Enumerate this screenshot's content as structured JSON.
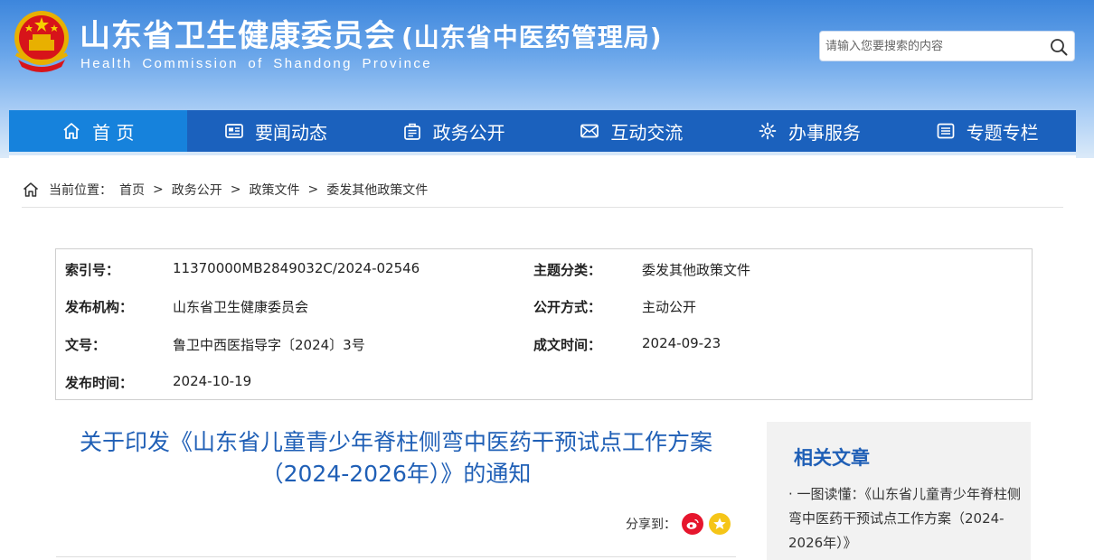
{
  "header": {
    "title": "山东省卫生健康委员会",
    "subtitle": "(山东省中医药管理局)",
    "english_name": "Health Commission of Shandong Province",
    "emblem_icon": "national-emblem-icon",
    "search": {
      "placeholder": "请输入您要搜索的内容",
      "icon": "search-icon"
    }
  },
  "nav": {
    "items": [
      {
        "label": "首 页",
        "icon": "home-icon",
        "active": true
      },
      {
        "label": "要闻动态",
        "icon": "news-icon"
      },
      {
        "label": "政务公开",
        "icon": "government-affairs-icon"
      },
      {
        "label": "互动交流",
        "icon": "envelope-icon"
      },
      {
        "label": "办事服务",
        "icon": "service-icon"
      },
      {
        "label": "专题专栏",
        "icon": "list-icon"
      }
    ]
  },
  "breadcrumb": {
    "prefix": "当前位置：",
    "items": [
      "首页",
      "政务公开",
      "政策文件",
      "委发其他政策文件"
    ],
    "separator": ">"
  },
  "metadata": {
    "index_no": {
      "label": "索引号：",
      "value": "11370000MB2849032C/2024-02546"
    },
    "topic": {
      "label": "主题分类：",
      "value": "委发其他政策文件"
    },
    "issuer": {
      "label": "发布机构：",
      "value": "山东省卫生健康委员会"
    },
    "disclosure": {
      "label": "公开方式：",
      "value": "主动公开"
    },
    "doc_no": {
      "label": "文号：",
      "value": "鲁卫中西医指导字〔2024〕3号"
    },
    "created": {
      "label": "成文时间：",
      "value": "2024-09-23"
    },
    "published": {
      "label": "发布时间：",
      "value": "2024-10-19"
    }
  },
  "article": {
    "title_line1": "关于印发《山东省儿童青少年脊柱侧弯中医药干预试点工作方案",
    "title_line2": "（2024-2026年）》的通知",
    "share_label": "分享到：",
    "share_buttons": [
      "weibo-icon",
      "qzone-icon"
    ]
  },
  "related": {
    "title": "相关文章",
    "items": [
      "· 一图读懂：《山东省儿童青少年脊柱侧弯中医药干预试点工作方案（2024-2026年）》"
    ]
  },
  "colors": {
    "nav_bg": "#1b61bd",
    "nav_active": "#1682dc",
    "title_blue": "#1f5fb6",
    "header_top": "#3d86dc",
    "weibo_red": "#e6162d",
    "qzone_yellow": "#f5c518"
  }
}
